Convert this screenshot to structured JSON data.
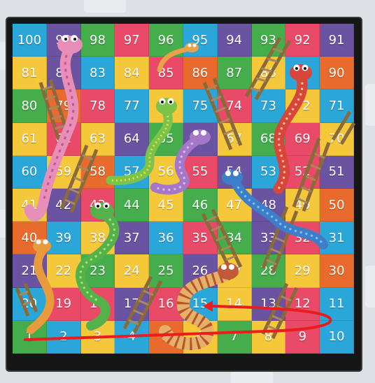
{
  "board": {
    "rows": [
      [
        100,
        99,
        98,
        97,
        96,
        95,
        94,
        93,
        92,
        91
      ],
      [
        81,
        82,
        83,
        84,
        85,
        86,
        87,
        88,
        89,
        90
      ],
      [
        80,
        79,
        78,
        77,
        76,
        75,
        74,
        73,
        72,
        71
      ],
      [
        61,
        62,
        63,
        64,
        65,
        66,
        67,
        68,
        69,
        70
      ],
      [
        60,
        59,
        58,
        57,
        56,
        55,
        54,
        53,
        52,
        51
      ],
      [
        41,
        42,
        43,
        44,
        45,
        46,
        47,
        48,
        49,
        50
      ],
      [
        40,
        39,
        38,
        37,
        36,
        35,
        34,
        33,
        32,
        31
      ],
      [
        21,
        22,
        23,
        24,
        25,
        26,
        27,
        28,
        29,
        30
      ],
      [
        20,
        19,
        18,
        17,
        16,
        15,
        14,
        13,
        12,
        11
      ],
      [
        1,
        2,
        3,
        4,
        5,
        6,
        7,
        8,
        9,
        10
      ]
    ],
    "colors": [
      [
        "#2aa7d8",
        "#6a53a0",
        "#45ad4b",
        "#e84a68",
        "#45ad4b",
        "#2aa7d8",
        "#6a53a0",
        "#45ad4b",
        "#e84a68",
        "#6a53a0"
      ],
      [
        "#f5c73a",
        "#6a53a0",
        "#2aa7d8",
        "#f5c73a",
        "#e84a68",
        "#e86a2c",
        "#45ad4b",
        "#f5c73a",
        "#2aa7d8",
        "#e86a2c"
      ],
      [
        "#45ad4b",
        "#e86a2c",
        "#e84a68",
        "#2aa7d8",
        "#f5c73a",
        "#2aa7d8",
        "#e84a68",
        "#2aa7d8",
        "#f5c73a",
        "#2aa7d8"
      ],
      [
        "#f5c73a",
        "#e84a68",
        "#f5c73a",
        "#6a53a0",
        "#45ad4b",
        "#6a53a0",
        "#f5c73a",
        "#45ad4b",
        "#e84a68",
        "#f5c73a"
      ],
      [
        "#2aa7d8",
        "#f5c73a",
        "#e86a2c",
        "#2aa7d8",
        "#f5c73a",
        "#e84a68",
        "#6a53a0",
        "#2aa7d8",
        "#e84a68",
        "#6a53a0"
      ],
      [
        "#f5c73a",
        "#6a53a0",
        "#e84a68",
        "#45ad4b",
        "#f5c73a",
        "#45ad4b",
        "#f5c73a",
        "#6a53a0",
        "#f5c73a",
        "#e86a2c"
      ],
      [
        "#e86a2c",
        "#2aa7d8",
        "#f5c73a",
        "#6a53a0",
        "#2aa7d8",
        "#e84a68",
        "#45ad4b",
        "#6a53a0",
        "#e84a68",
        "#2aa7d8"
      ],
      [
        "#6a53a0",
        "#f5c73a",
        "#45ad4b",
        "#f5c73a",
        "#45ad4b",
        "#6a53a0",
        "#f5c73a",
        "#45ad4b",
        "#f5c73a",
        "#e86a2c"
      ],
      [
        "#2aa7d8",
        "#e84a68",
        "#e84a68",
        "#6a53a0",
        "#e84a68",
        "#2aa7d8",
        "#f5c73a",
        "#6a53a0",
        "#e84a68",
        "#2aa7d8"
      ],
      [
        "#45ad4b",
        "#2aa7d8",
        "#f5c73a",
        "#2aa7d8",
        "#e86a2c",
        "#f5c73a",
        "#45ad4b",
        "#f5c73a",
        "#e84a68",
        "#2aa7d8"
      ]
    ]
  },
  "theme": {
    "frame": "#161616",
    "ladder_rail": "#8a6a3a",
    "ladder_rung": "#a8885a",
    "move_arrow": "#e81e1e"
  },
  "snakes": [
    {
      "name": "pink-snake",
      "body": "#e78fb8",
      "pattern": "#c75492"
    },
    {
      "name": "small-orange-snake",
      "body": "#e8a24a",
      "pattern": "#b86a1e"
    },
    {
      "name": "red-snake",
      "body": "#d8453a",
      "pattern": "#f2c3a0"
    },
    {
      "name": "green-snake-top",
      "body": "#7cc34a",
      "pattern": "#e4de4a"
    },
    {
      "name": "purple-snake",
      "body": "#a577c8",
      "pattern": "#d9b8ee"
    },
    {
      "name": "blue-snake",
      "body": "#3d7ec9",
      "pattern": "#7cc3ee"
    },
    {
      "name": "green-snake-middle",
      "body": "#55b24a",
      "pattern": "#a9e07a"
    },
    {
      "name": "orange-snake-left",
      "body": "#e89a3c",
      "pattern": "#f6d28c"
    },
    {
      "name": "striped-snake",
      "body": "#e5b06a",
      "pattern": "#b8542a"
    }
  ]
}
